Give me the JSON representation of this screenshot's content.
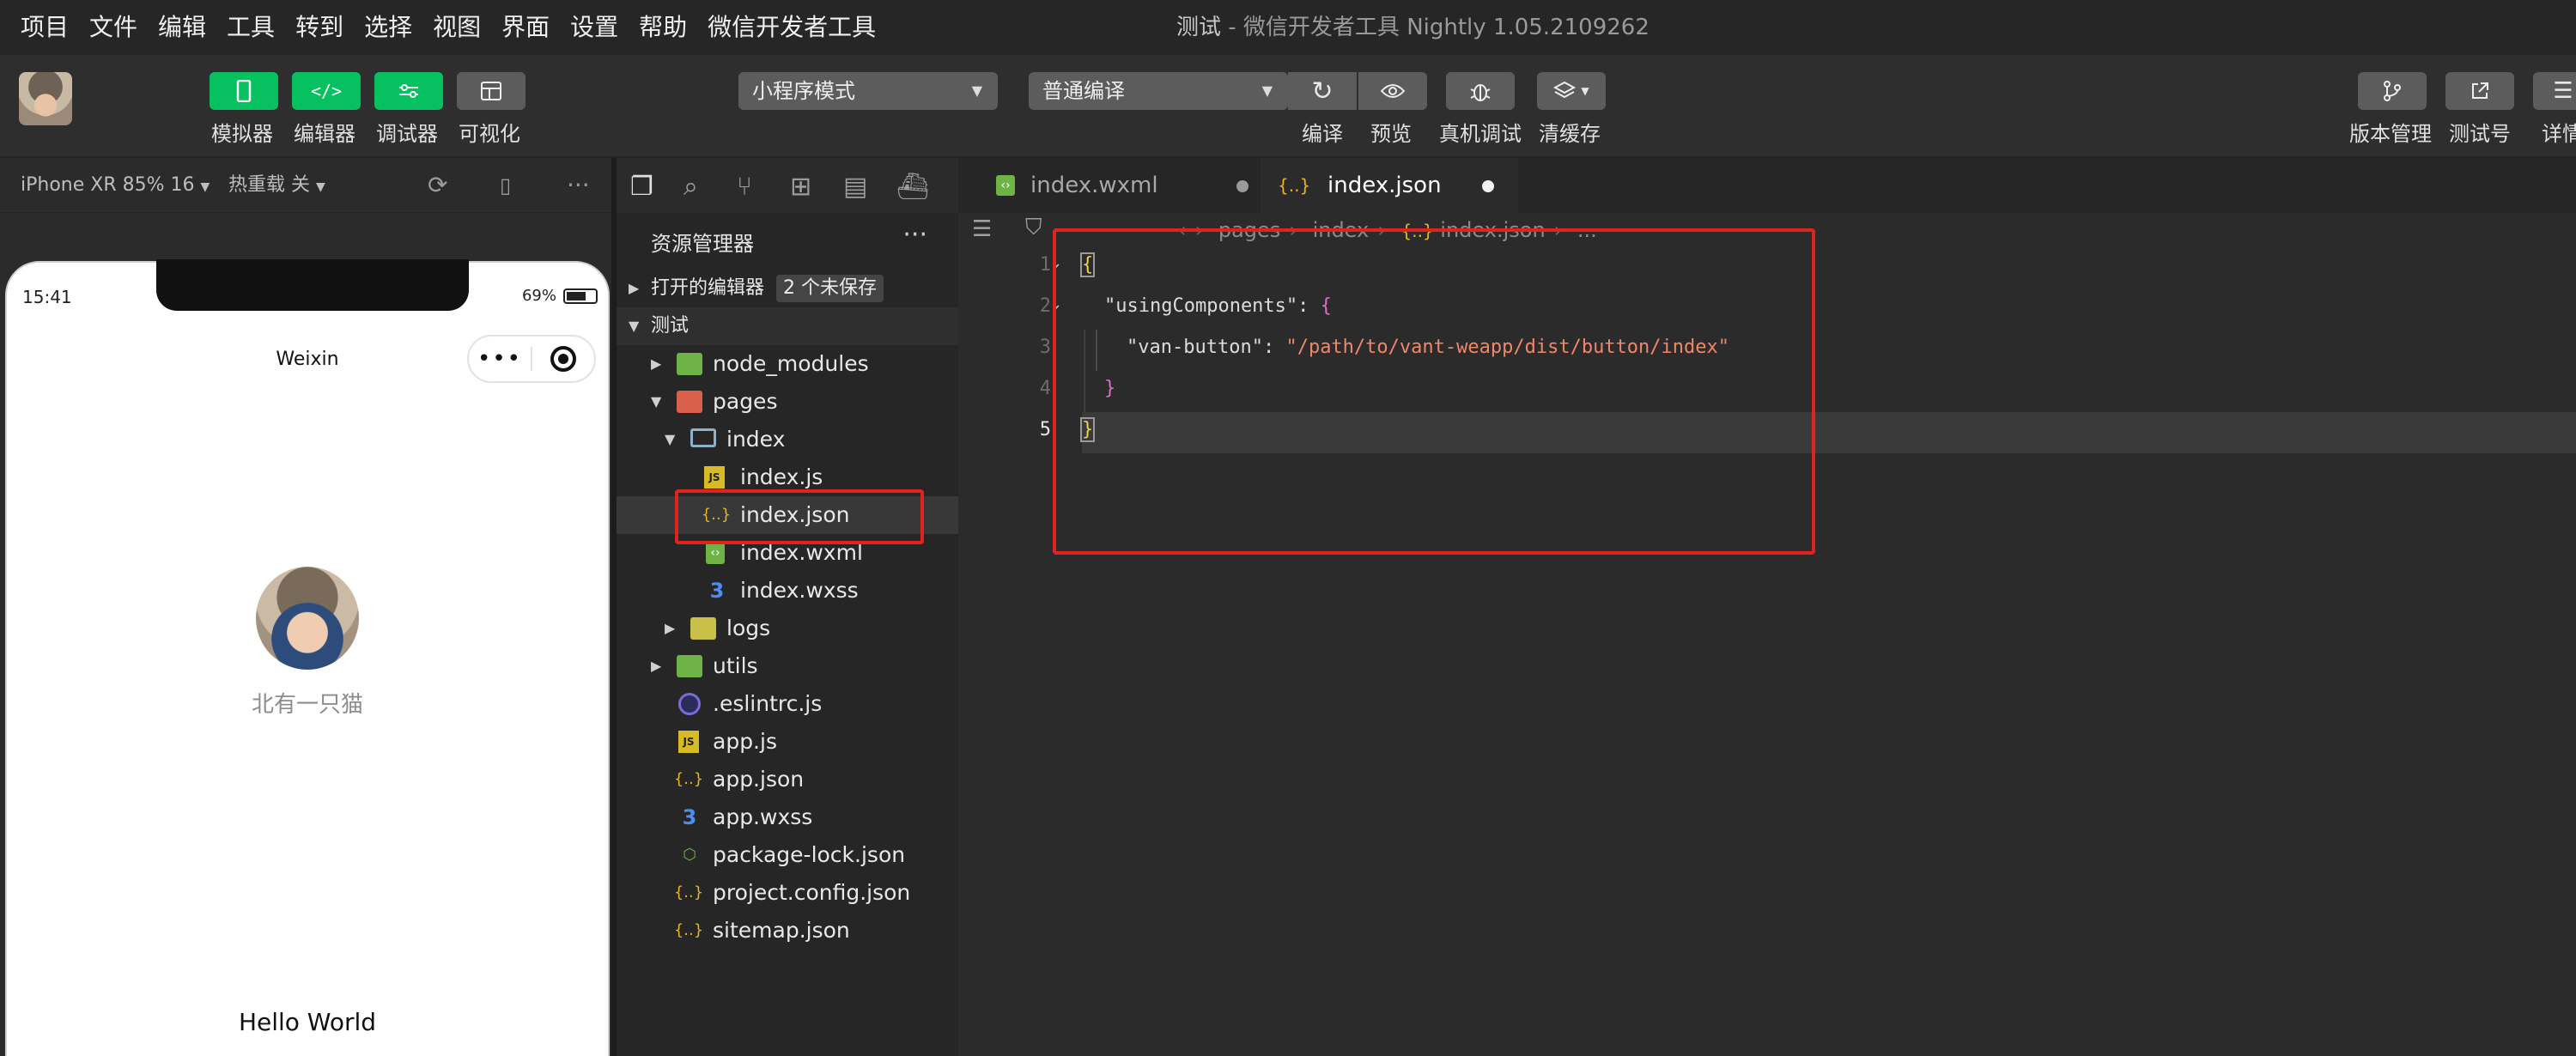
{
  "menubar": {
    "items": [
      "项目",
      "文件",
      "编辑",
      "工具",
      "转到",
      "选择",
      "视图",
      "界面",
      "设置",
      "帮助",
      "微信开发者工具"
    ],
    "project": "测试",
    "title_rest": " - 微信开发者工具 Nightly 1.05.2109262"
  },
  "toolbar": {
    "simulator": "模拟器",
    "editor": "编辑器",
    "debugger": "调试器",
    "visual": "可视化",
    "mode": "小程序模式",
    "compile_mode": "普通编译",
    "compile": "编译",
    "preview": "预览",
    "remote_debug": "真机调试",
    "clear_cache": "清缓存",
    "version_mgmt": "版本管理",
    "test_id": "测试号",
    "details": "详情"
  },
  "simulator": {
    "device": "iPhone XR 85% 16",
    "hot_reload": "热重载 关",
    "time": "15:41",
    "battery": "69%",
    "nav_title": "Weixin",
    "capsule_dots": "•••",
    "user_name": "北有一只猫",
    "hello": "Hello World"
  },
  "explorer": {
    "title": "资源管理器",
    "more": "···",
    "open_editors": "打开的编辑器",
    "unsaved_badge": "2 个未保存",
    "root": "测试",
    "items": [
      {
        "name": "node_modules"
      },
      {
        "name": "pages"
      },
      {
        "name": "index"
      },
      {
        "name": "index.js"
      },
      {
        "name": "index.json"
      },
      {
        "name": "index.wxml"
      },
      {
        "name": "index.wxss"
      },
      {
        "name": "logs"
      },
      {
        "name": "utils"
      },
      {
        "name": ".eslintrc.js"
      },
      {
        "name": "app.js"
      },
      {
        "name": "app.json"
      },
      {
        "name": "app.wxss"
      },
      {
        "name": "package-lock.json"
      },
      {
        "name": "project.config.json"
      },
      {
        "name": "sitemap.json"
      }
    ]
  },
  "editor": {
    "tabs": [
      {
        "label": "index.wxml"
      },
      {
        "label": "index.json"
      }
    ],
    "breadcrumb": [
      "pages",
      "index",
      "index.json",
      "..."
    ],
    "line_numbers": [
      "1",
      "2",
      "3",
      "4",
      "5"
    ],
    "code": {
      "line1": "{",
      "line2_key": "\"usingComponents\"",
      "line2_rest": ": ",
      "line2_brace": "{",
      "line3_key": "\"van-button\"",
      "line3_colon": ": ",
      "line3_val": "\"/path/to/vant-weapp/dist/button/index\"",
      "line4": "}",
      "line5": "}"
    },
    "icons": {
      "json": "{..}",
      "js": "JS",
      "wxss": "3"
    }
  },
  "colors": {
    "accent_green": "#07c160",
    "highlight_red": "#e0231c",
    "json_icon": "#e6b422",
    "string": "#f0876a"
  }
}
